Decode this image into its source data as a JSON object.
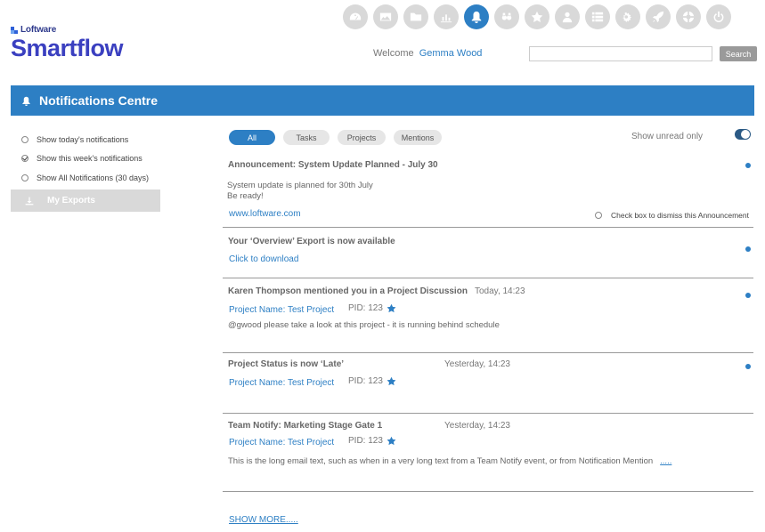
{
  "topbar": {
    "icons": [
      {
        "name": "dashboard-icon",
        "active": false
      },
      {
        "name": "image-icon",
        "active": false
      },
      {
        "name": "folder-icon",
        "active": false
      },
      {
        "name": "bar-chart-icon",
        "active": false
      },
      {
        "name": "bell-icon",
        "active": true
      },
      {
        "name": "binoculars-icon",
        "active": false
      },
      {
        "name": "star-icon",
        "active": false
      },
      {
        "name": "user-icon",
        "active": false
      },
      {
        "name": "list-icon",
        "active": false
      },
      {
        "name": "gears-icon",
        "active": false
      },
      {
        "name": "rocket-icon",
        "active": false
      },
      {
        "name": "lifebuoy-icon",
        "active": false
      },
      {
        "name": "power-icon",
        "active": false
      }
    ]
  },
  "brand": {
    "small": "Loftware",
    "big": "Smartflow"
  },
  "header": {
    "welcome_label": "Welcome",
    "user_name": "Gemma Wood",
    "search_button": "Search",
    "search_value": ""
  },
  "page": {
    "title": "Notifications Centre"
  },
  "sidebar": {
    "options": [
      {
        "label": "Show today's notifications",
        "checked": false
      },
      {
        "label": "Show this week's notifications",
        "checked": true
      },
      {
        "label": "Show All Notifications (30 days)",
        "checked": false
      }
    ],
    "exports_label": "My Exports"
  },
  "filters": {
    "pills": [
      "All",
      "Tasks",
      "Projects",
      "Mentions"
    ],
    "active": "All",
    "unread_label": "Show unread only",
    "unread_on": true
  },
  "notifications": [
    {
      "title": "Announcement: System Update Planned - July 30",
      "line1": "System update is planned for 30th July",
      "line2": "Be ready!",
      "link": "www.loftware.com",
      "dismiss_label": "Check box to dismiss this Announcement",
      "unread": true
    },
    {
      "title": "Your ‘Overview’ Export is now available",
      "link": "Click to download",
      "unread": true
    },
    {
      "title": "Karen Thompson mentioned you in a Project Discussion",
      "time": "Today, 14:23",
      "project": "Project Name: Test Project",
      "pid": "PID: 123",
      "text": "@gwood please take a look at this project - it is running behind schedule",
      "unread": true
    },
    {
      "title": "Project Status is now ‘Late’",
      "time": "Yesterday, 14:23",
      "project": "Project Name: Test Project",
      "pid": "PID: 123",
      "unread": true
    },
    {
      "title": "Team Notify: Marketing Stage Gate 1",
      "time": "Yesterday, 14:23",
      "project": "Project Name: Test Project",
      "pid": "PID: 123",
      "text": "This is the long email text, such as when in a very long text from a Team Notify event, or from Notification Mention",
      "more": ".....",
      "unread": false
    }
  ],
  "footer": {
    "show_more": "SHOW MORE....."
  },
  "colors": {
    "accent": "#2d7fc4",
    "brand": "#3b40c0",
    "icon_bg": "#d9d9d9",
    "toggle": "#2b5a85"
  }
}
